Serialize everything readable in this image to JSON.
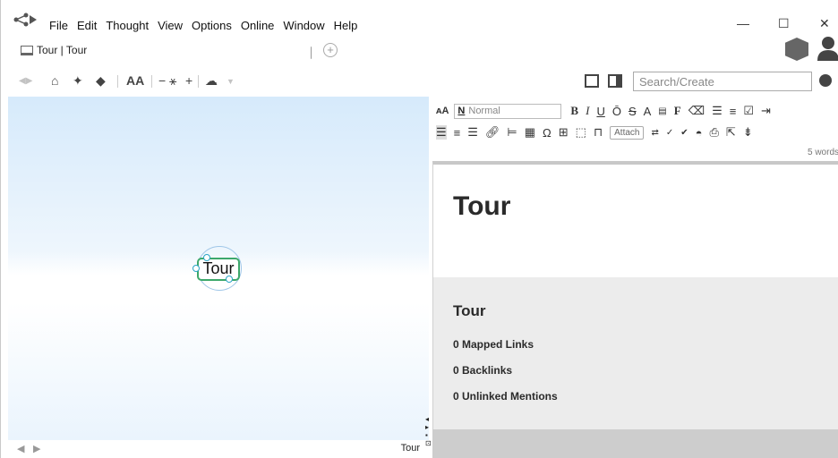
{
  "menu": {
    "items": [
      "File",
      "Edit",
      "Thought",
      "View",
      "Options",
      "Online",
      "Window",
      "Help"
    ],
    "minimize": "—",
    "maximize": "☐",
    "close": "✕"
  },
  "tabs": [
    {
      "label": "Tour | Tour"
    }
  ],
  "new_tab_symbol": "+",
  "toolbar": {
    "font_size_label": "AA",
    "search_placeholder": "Search/Create"
  },
  "plex": {
    "active_thought": "Tour",
    "footer_thought_name": "Tour",
    "back_arrow": "◀",
    "forward_arrow": "▶"
  },
  "editor": {
    "style_letter": "N",
    "style_name": "Normal",
    "attach_label": "Attach",
    "word_count": "5 words",
    "note_title": "Tour",
    "backlinks": {
      "title": "Tour",
      "mapped_links": "0 Mapped Links",
      "backlinks": "0 Backlinks",
      "unlinked_mentions": "0 Unlinked Mentions"
    }
  },
  "colors": {
    "accent_green": "#3da86b",
    "gate_blue": "#2aa4c7",
    "plex_blue": "#d6eafb"
  }
}
